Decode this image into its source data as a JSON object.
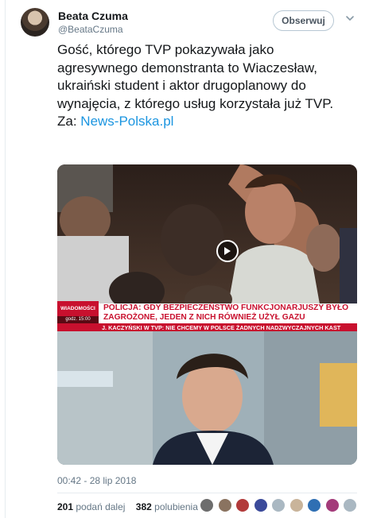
{
  "author": {
    "name": "Beata Czuma",
    "handle": "@BeataCzuma"
  },
  "follow_label": "Obserwuj",
  "tweet": {
    "text": "Gość, którego TVP pokazywała jako agresywnego demonstranta to Wiaczesław, ukraiński student i aktor drugoplanowy do wynajęcia, z którego usług korzystała już TVP.  Za: ",
    "link": "News-Polska.pl"
  },
  "media": {
    "channel": "WIADOMOŚCI",
    "clock": "godz. 15:00",
    "headline": "POLICJA: GDY BEZPIECZEŃSTWO FUNKCJONARJUSZY BYŁO ZAGROŻONE, JEDEN Z NICH RÓWNIEŻ UŻYŁ GAZU",
    "ticker": "J. KACZYŃSKI W TVP: NIE CHCEMY W POLSCE ŻADNYCH NADZWYCZAJNYCH KAST"
  },
  "timestamp": "00:42 - 28 lip 2018",
  "stats": {
    "retweets_count": "201",
    "retweets_label": "podań dalej",
    "likes_count": "382",
    "likes_label": "polubienia"
  },
  "likers": [
    "#6d6d6d",
    "#8a7360",
    "#b23a3a",
    "#3b4a9a",
    "#aab8c2",
    "#c9b49a",
    "#2f6fb3",
    "#a33b7a",
    "#aab8c2"
  ]
}
